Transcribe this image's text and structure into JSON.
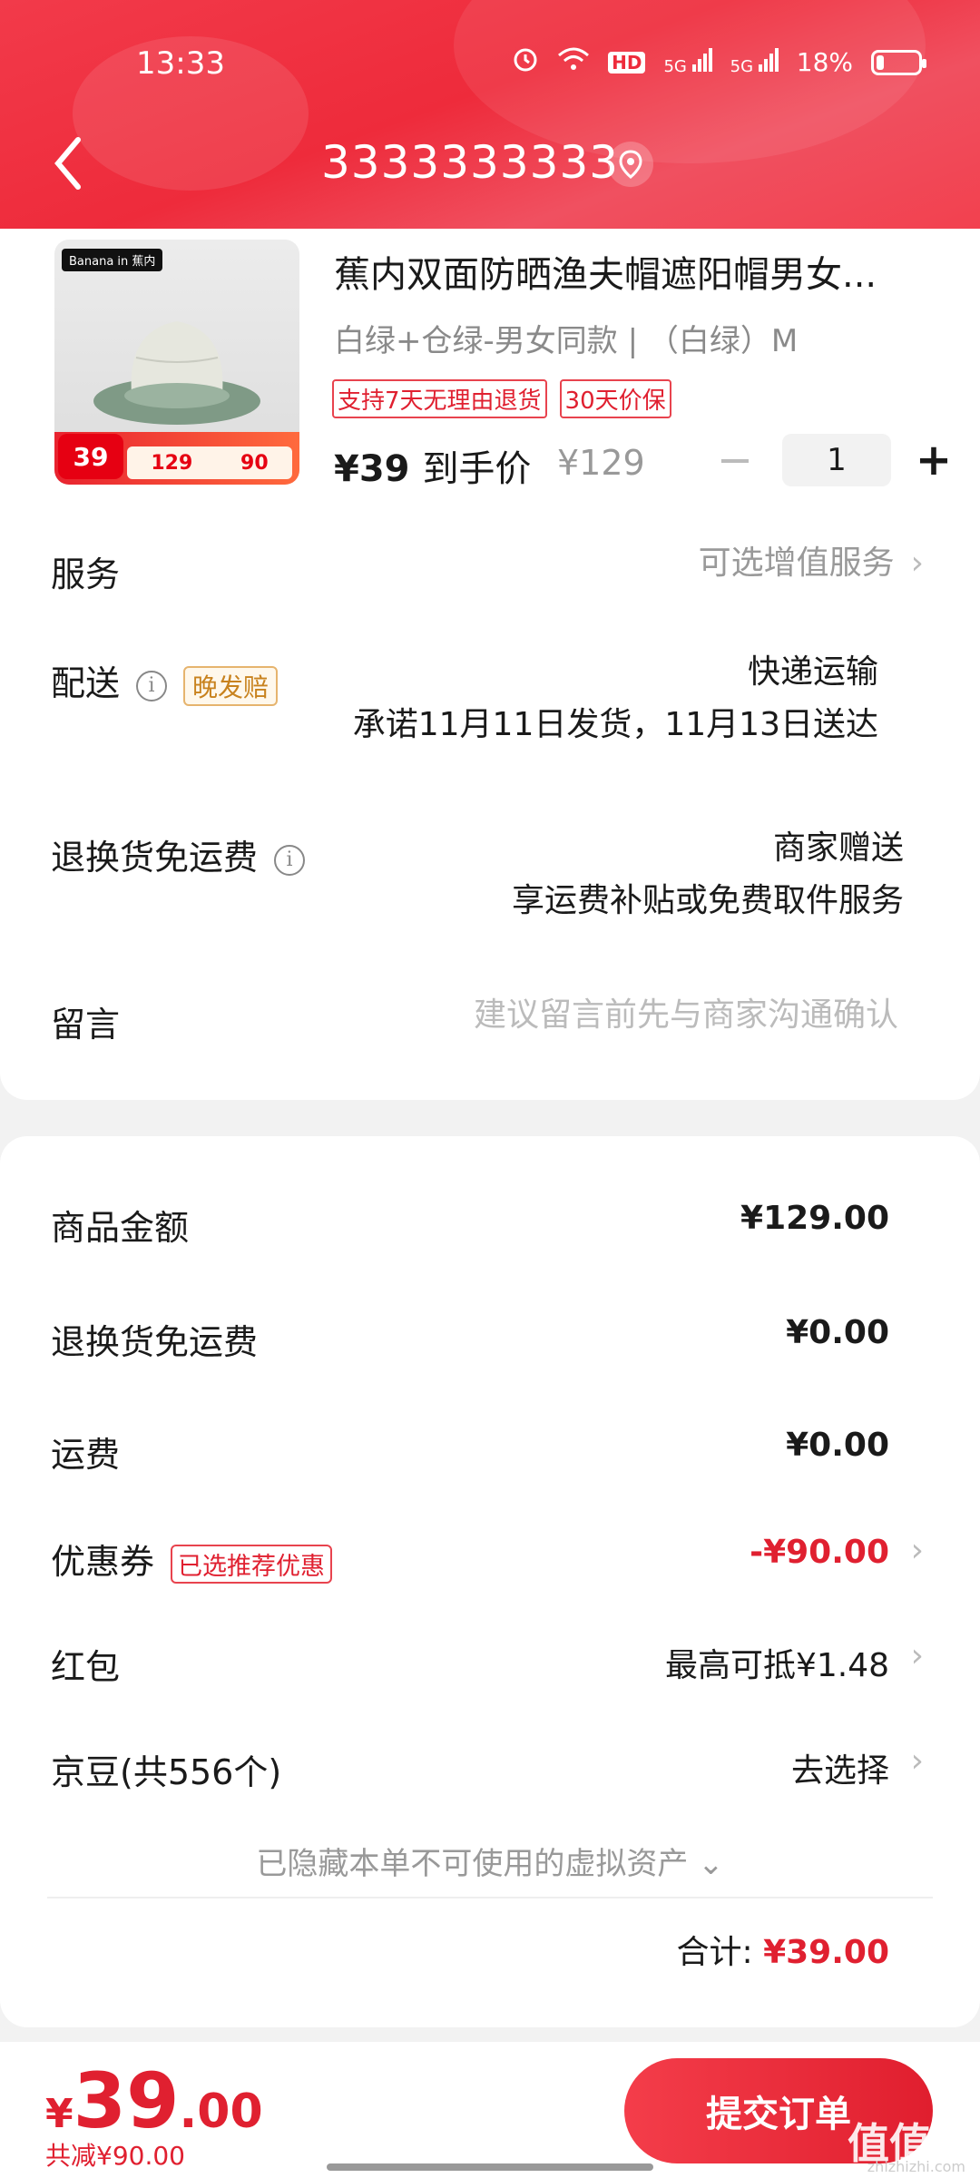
{
  "status_bar": {
    "time": "13:33",
    "network_hd": "HD",
    "sig1": "5G",
    "sig2": "5G",
    "battery": "18%",
    "battery_level": 0.18
  },
  "nav": {
    "title": "3333333333"
  },
  "product": {
    "brand_badge": "Banana in 蕉内",
    "thumb_price": "39",
    "thumb_orig": "129",
    "thumb_coupon": "90",
    "name": "蕉内双面防晒渔夫帽遮阳帽男女...",
    "spec": "白绿+仓绿-男女同款 | （白绿）M",
    "tags": [
      "支持7天无理由退货",
      "30天价保"
    ],
    "price": "¥39",
    "price_suffix": "到手价",
    "orig_price": "¥129",
    "quantity": "1"
  },
  "rows": {
    "service": {
      "label": "服务",
      "value": "可选增值服务"
    },
    "delivery": {
      "label": "配送",
      "badge": "晚发赔",
      "method": "快递运输",
      "promise": "承诺11月11日发货，11月13日送达"
    },
    "return": {
      "label": "退换货免运费",
      "value1": "商家赠送",
      "value2": "享运费补贴或免费取件服务"
    },
    "message": {
      "label": "留言",
      "placeholder": "建议留言前先与商家沟通确认"
    }
  },
  "summary": {
    "goods_label": "商品金额",
    "goods_value": "¥129.00",
    "return_label": "退换货免运费",
    "return_value": "¥0.00",
    "freight_label": "运费",
    "freight_value": "¥0.00",
    "coupon_label": "优惠券",
    "coupon_tag": "已选推荐优惠",
    "coupon_value": "-¥90.00",
    "redpacket_label": "红包",
    "redpacket_value": "最高可抵¥1.48",
    "jingdou_label": "京豆(共556个)",
    "jingdou_value": "去选择",
    "hidden_note": "已隐藏本单不可使用的虚拟资产",
    "total_label": "合计:",
    "total_value": "¥39.00"
  },
  "bottom": {
    "currency": "¥",
    "price_int": "39",
    "price_dec": ".00",
    "saved": "共减¥90.00",
    "submit": "提交订单",
    "watermark": "值值值",
    "watermark_sub": "zhizhizhi.com"
  }
}
